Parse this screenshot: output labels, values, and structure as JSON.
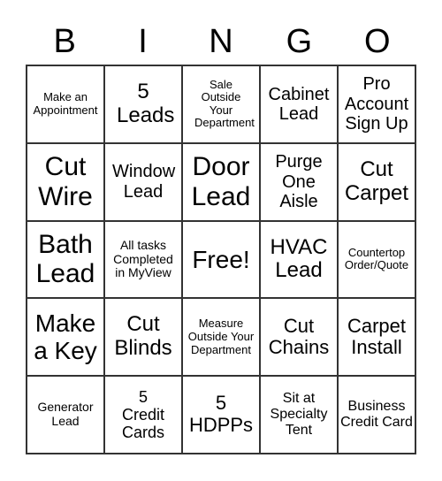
{
  "header": [
    "B",
    "I",
    "N",
    "G",
    "O"
  ],
  "cells": [
    "Make an Appointment",
    "5 Leads",
    "Sale Outside Your Department",
    "Cabinet Lead",
    "Pro Account Sign Up",
    "Cut Wire",
    "Window Lead",
    "Door Lead",
    "Purge One Aisle",
    "Cut Carpet",
    "Bath Lead",
    "All tasks Completed in MyView",
    "Free!",
    "HVAC Lead",
    "Countertop Order/Quote",
    "Make a Key",
    "Cut Blinds",
    "Measure Outside Your Department",
    "Cut Chains",
    "Carpet Install",
    "Generator Lead",
    "5 Credit Cards",
    "5 HDPPs",
    "Sit at Specialty Tent",
    "Business Credit Card"
  ]
}
